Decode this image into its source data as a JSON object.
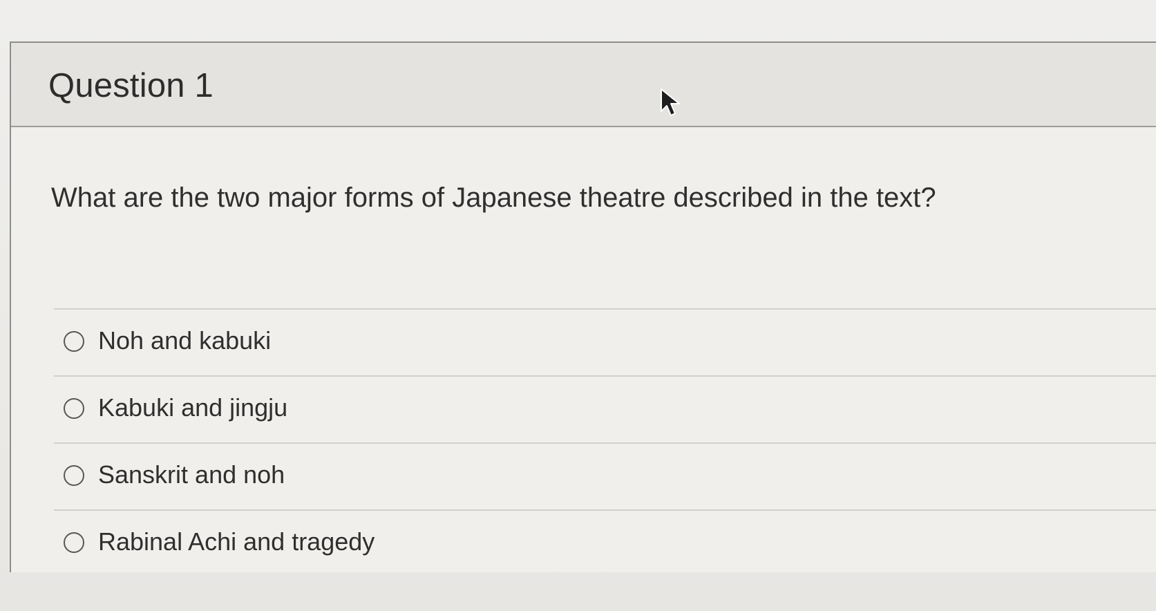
{
  "question": {
    "title": "Question 1",
    "prompt": "What are the two major forms of Japanese theatre described in the text?",
    "options": [
      {
        "label": "Noh and kabuki",
        "selected": false
      },
      {
        "label": "Kabuki and jingju",
        "selected": false
      },
      {
        "label": "Sanskrit and noh",
        "selected": false
      },
      {
        "label": "Rabinal Achi and tragedy",
        "selected": false
      }
    ]
  },
  "icons": {
    "cursor": "mouse-pointer-arrow",
    "option_control": "radio-circle"
  },
  "colors": {
    "background": "#ecebe8",
    "header_background": "#e4e3e0",
    "body_background": "#f0efec",
    "text": "#2f2f2f",
    "border": "#8d8d8b",
    "divider": "#cfcfcc"
  }
}
